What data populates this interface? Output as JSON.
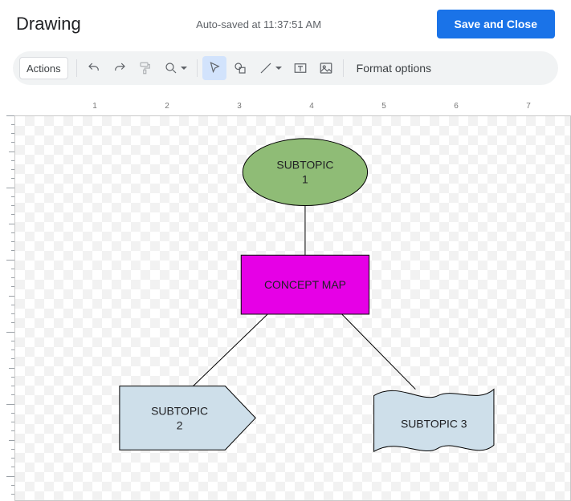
{
  "header": {
    "title": "Drawing",
    "status": "Auto-saved at 11:37:51 AM",
    "save_label": "Save and Close"
  },
  "toolbar": {
    "actions_label": "Actions",
    "format_options_label": "Format options"
  },
  "ruler": {
    "h": [
      "1",
      "2",
      "3",
      "4",
      "5",
      "6",
      "7"
    ]
  },
  "shapes": {
    "ellipse": {
      "line1": "SUBTOPIC",
      "line2": "1"
    },
    "rect": {
      "label": "CONCEPT MAP"
    },
    "arrow": {
      "line1": "SUBTOPIC",
      "line2": "2"
    },
    "wave": {
      "label": "SUBTOPIC 3"
    }
  }
}
